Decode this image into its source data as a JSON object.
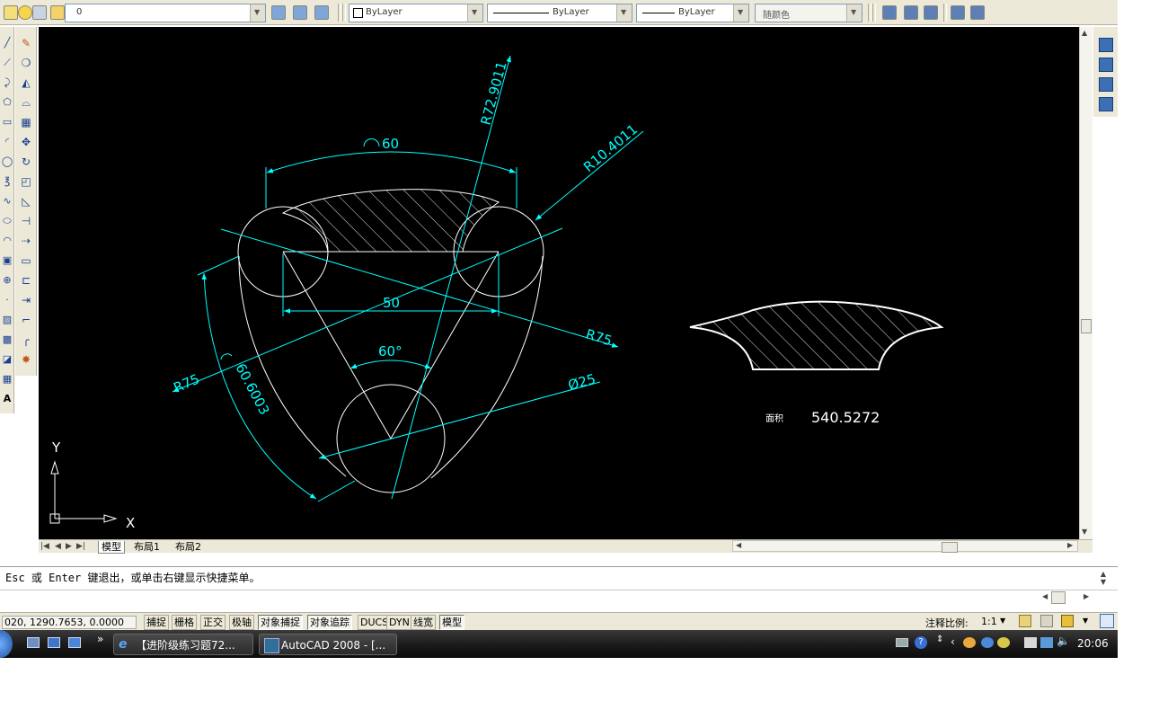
{
  "toolbar": {
    "layer_name": "0",
    "color_combo": "ByLayer",
    "linetype_combo": "ByLayer",
    "lineweight_combo": "ByLayer",
    "plotstyle_combo": "随颜色"
  },
  "drawing": {
    "dims": {
      "arc60": "60",
      "r72": "R72.9011",
      "r10": "R10.4011",
      "len50": "50",
      "r75_right": "R75",
      "r75_left": "R75",
      "ang60": "60°",
      "dia25": "Ø25",
      "arc_len": "60.6003"
    },
    "area_label": "面积",
    "area_value": "540.5272",
    "ucs_y": "Y",
    "ucs_x": "X"
  },
  "tabs": [
    "模型",
    "布局1",
    "布局2"
  ],
  "command_line": {
    "message": "Esc 或 Enter 键退出，或单击右键显示快捷菜单。"
  },
  "status": {
    "coords": "020, 1290.7653, 0.0000",
    "toggles": [
      "捕捉",
      "栅格",
      "正交",
      "极轴",
      "对象捕捉",
      "对象追踪",
      "DUCS",
      "DYN",
      "线宽",
      "模型"
    ],
    "annotation_scale_label": "注释比例:",
    "annotation_scale_value": "1:1"
  },
  "taskbar": {
    "tasks": [
      "【进阶级练习题72...",
      "AutoCAD 2008 - [..."
    ],
    "clock": "20:06"
  },
  "colors": {
    "canvas": "#000000",
    "dimension": "#00ffff",
    "geometry": "#ffffff"
  }
}
